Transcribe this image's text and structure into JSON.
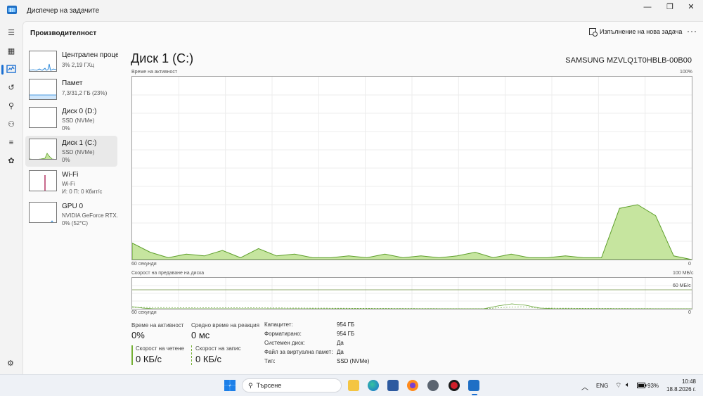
{
  "app": {
    "title": "Диспечер на задачите"
  },
  "header": {
    "title": "Производителност",
    "run_task": "Изпълнение на нова задача"
  },
  "devices": [
    {
      "name": "Централен процесор",
      "sub": "3%  2,19 ГХц",
      "color": "#1a7fd6"
    },
    {
      "name": "Памет",
      "sub": "7,3/31,2 ГБ (23%)",
      "color": "#1a7fd6"
    },
    {
      "name": "Диск 0 (D:)",
      "sub": "SSD (NVMe)",
      "sub2": "0%",
      "color": "#4c9a2a"
    },
    {
      "name": "Диск 1 (C:)",
      "sub": "SSD (NVMe)",
      "sub2": "0%",
      "color": "#4c9a2a"
    },
    {
      "name": "Wi-Fi",
      "sub": "Wi-Fi",
      "sub2": "И: 0  П: 0 Кбит/с",
      "color": "#b0295a"
    },
    {
      "name": "GPU 0",
      "sub": "NVIDIA GeForce RTX...",
      "sub2": "0%  (52°C)",
      "color": "#1a7fd6"
    }
  ],
  "detail": {
    "title": "Диск 1 (C:)",
    "model": "SAMSUNG MZVLQ1T0HBLB-00B00",
    "graph1": {
      "top_label": "Време на активност",
      "top_right": "100%",
      "bottom_label": "60 секунди",
      "bottom_right": "0"
    },
    "graph2": {
      "top_label": "Скорост на предаване на диска",
      "top_right": "100 МБ/с",
      "ref_label": "60 МБ/с",
      "bottom_label": "60 секунди",
      "bottom_right": "0"
    },
    "stats": {
      "active_label": "Време на активност",
      "active_value": "0%",
      "response_label": "Средно време на реакция",
      "response_value": "0 мс",
      "read_label": "Скорост на четене",
      "read_value": "0 КБ/с",
      "write_label": "Скорост на запис",
      "write_value": "0 КБ/с"
    },
    "props": [
      {
        "label": "Капацитет:",
        "value": "954 ГБ"
      },
      {
        "label": "Форматирано:",
        "value": "954 ГБ"
      },
      {
        "label": "Системен диск:",
        "value": "Да"
      },
      {
        "label": "Файл за виртуална памет:",
        "value": "Да"
      },
      {
        "label": "Тип:",
        "value": "SSD (NVMe)"
      }
    ]
  },
  "chart_data": {
    "type": "area",
    "x": [
      60,
      58,
      56,
      54,
      52,
      50,
      48,
      46,
      44,
      42,
      40,
      38,
      36,
      34,
      32,
      30,
      28,
      26,
      24,
      22,
      20,
      18,
      16,
      14,
      12,
      10,
      8,
      6,
      4,
      2,
      0
    ],
    "series": [
      {
        "values": [
          9,
          4,
          1,
          3,
          2,
          5,
          1,
          6,
          2,
          3,
          1,
          1,
          2,
          1,
          3,
          1,
          2,
          1,
          2,
          4,
          1,
          3,
          1,
          1,
          2,
          1,
          1,
          28,
          30,
          24,
          2,
          0
        ]
      }
    ],
    "ylim": [
      0,
      100
    ],
    "colors": {
      "line": "#5d9f2a",
      "fill": "#c6e59f"
    }
  },
  "taskbar": {
    "search": "Търсене",
    "lang": "ENG",
    "battery": "93%",
    "time": "10:48",
    "date": "18.8.2026 г."
  }
}
